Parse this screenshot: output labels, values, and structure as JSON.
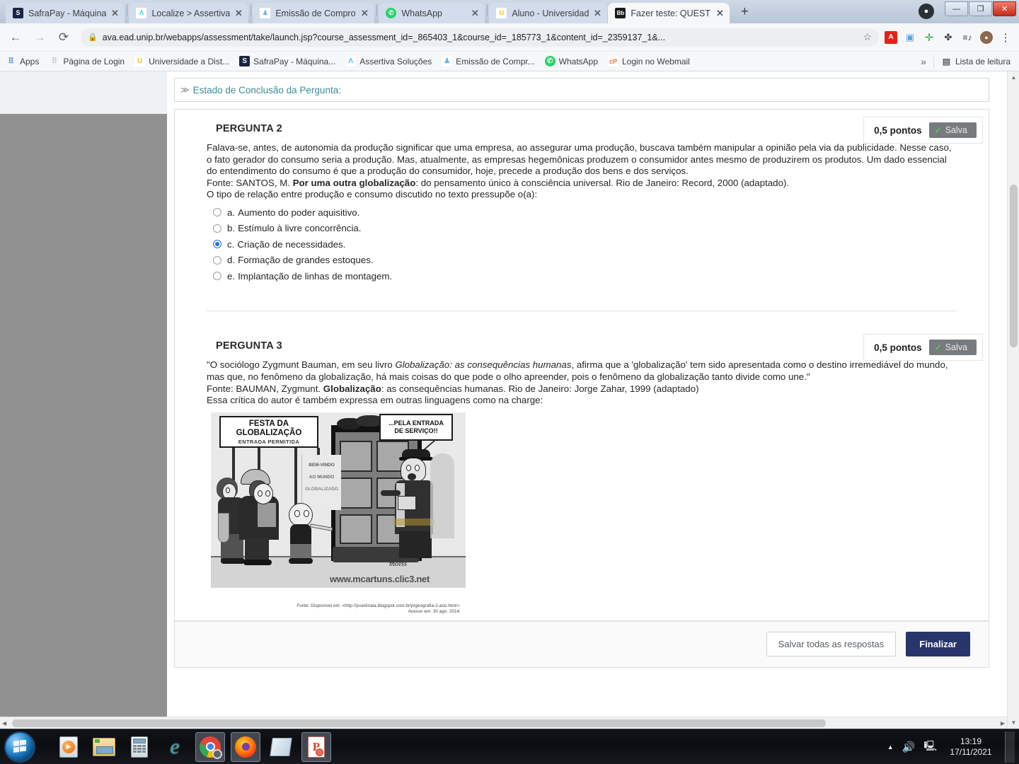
{
  "browser": {
    "tabs": [
      {
        "title": "SafraPay - Máquina ",
        "favicon": "safrapay-icon",
        "favicon_color": "#1b2440",
        "favicon_glyph": "S",
        "active": false
      },
      {
        "title": "Localize > Assertiva",
        "favicon": "assertiva-icon",
        "favicon_color": "#ffffff",
        "favicon_glyph": "A",
        "active": false
      },
      {
        "title": "Emissão de Comprov",
        "favicon": "prefeitura-icon",
        "favicon_color": "#ffffff",
        "favicon_glyph": "E",
        "active": false
      },
      {
        "title": "WhatsApp",
        "favicon": "whatsapp-icon",
        "favicon_color": "#25d366",
        "favicon_glyph": "W",
        "active": false
      },
      {
        "title": "Aluno - Universidad",
        "favicon": "unip-icon",
        "favicon_color": "#ffffff",
        "favicon_glyph": "U",
        "active": false
      },
      {
        "title": "Fazer teste: QUESTIO",
        "favicon": "blackboard-icon",
        "favicon_color": "#1a1a1a",
        "favicon_glyph": "Bb",
        "active": true
      }
    ],
    "new_tab_label": "+",
    "close_label": "✕",
    "window_controls": {
      "minimize": "—",
      "maximize": "❐",
      "close": "✕"
    },
    "nav": {
      "back": "←",
      "forward": "→",
      "reload": "⟳"
    },
    "omnibox": {
      "lock_icon": "lock-icon",
      "url": "ava.ead.unip.br/webapps/assessment/take/launch.jsp?course_assessment_id=_865403_1&course_id=_185773_1&content_id=_2359137_1&...",
      "star_icon": "☆"
    },
    "extensions": [
      {
        "name": "adobe-acrobat-icon",
        "glyph": "A",
        "color": "#e2231a"
      },
      {
        "name": "evernote-webclipper-icon",
        "glyph": "▣",
        "color": "#5ba4e5"
      },
      {
        "name": "add-extension-icon",
        "glyph": "✛",
        "color": "#34a853"
      },
      {
        "name": "extensions-puzzle-icon",
        "glyph": "🧩",
        "color": "#3c4043"
      },
      {
        "name": "reading-list-icon",
        "glyph": "≡♪",
        "color": "#3c4043"
      },
      {
        "name": "profile-avatar-icon",
        "glyph": "●",
        "color": "#8a6a4e"
      },
      {
        "name": "chrome-menu-icon",
        "glyph": "⋮",
        "color": "#3c4043"
      }
    ],
    "bookmarks": [
      {
        "label": "Apps",
        "icon": "apps-grid-icon",
        "color": "#4285f4",
        "glyph": "⋮⋮"
      },
      {
        "label": "Página de Login",
        "icon": "login-page-icon",
        "color": "#cfd8e3",
        "glyph": "⋮⋮"
      },
      {
        "label": "Universidade a Dist...",
        "icon": "unip-icon",
        "color": "#ffffff",
        "glyph": "U"
      },
      {
        "label": "SafraPay - Máquina...",
        "icon": "safrapay-icon",
        "color": "#1b2440",
        "glyph": "S"
      },
      {
        "label": "Assertiva Soluções",
        "icon": "assertiva-icon",
        "color": "#ffffff",
        "glyph": "A"
      },
      {
        "label": "Emissão de Compr...",
        "icon": "prefeitura-icon",
        "color": "#ffffff",
        "glyph": "E"
      },
      {
        "label": "WhatsApp",
        "icon": "whatsapp-icon",
        "color": "#25d366",
        "glyph": "W"
      },
      {
        "label": "Login no Webmail",
        "icon": "cpanel-icon",
        "color": "#ffffff",
        "glyph": "cP"
      }
    ],
    "bookmarks_overflow": "»",
    "reading_list": {
      "label": "Lista de leitura",
      "icon": "reading-list-icon"
    }
  },
  "page": {
    "status_header": {
      "chevron": "≫",
      "label": "Estado de Conclusão da Pergunta:"
    },
    "questions": [
      {
        "title": "PERGUNTA 2",
        "points": "0,5 pontos",
        "saved_label": "Salva",
        "saved_check": "✓",
        "paragraphs": [
          {
            "type": "plain",
            "text": "Falava-se, antes, de autonomia da produção significar que uma empresa, ao assegurar uma produção, buscava também manipular a opinião pela via da publicidade. Nesse caso, o fato gerador do consumo seria a produção. Mas, atualmente, as empresas hegemônicas produzem o consumidor antes mesmo de produzirem os produtos. Um dado essencial do entendimento do consumo é que a produção do consumidor, hoje, precede a produção dos bens e dos serviços."
          },
          {
            "type": "source",
            "prefix": "Fonte: SANTOS, M. ",
            "bold": "Por uma outra globalização",
            "rest": ": do pensamento único à consciência universal. Rio de Janeiro: Record, 2000 (adaptado)."
          },
          {
            "type": "plain",
            "text": "O tipo de relação entre produção e consumo discutido no texto pressupõe o(a):"
          }
        ],
        "answers": [
          {
            "letter": "a.",
            "text": "Aumento do poder aquisitivo.",
            "selected": false
          },
          {
            "letter": "b.",
            "text": "Estímulo à livre concorrência.",
            "selected": false
          },
          {
            "letter": "c.",
            "text": "Criação de necessidades.",
            "selected": true
          },
          {
            "letter": "d.",
            "text": "Formação de grandes estoques.",
            "selected": false
          },
          {
            "letter": "e.",
            "text": "Implantação de linhas de montagem.",
            "selected": false
          }
        ]
      },
      {
        "title": "PERGUNTA 3",
        "points": "0,5 pontos",
        "saved_label": "Salva",
        "saved_check": "✓",
        "quote_pre": "\"O sociólogo Zygmunt Bauman, em seu livro ",
        "quote_italic": "Globalização: as consequências humanas",
        "quote_post": ", afirma que a 'globalização' tem sido apresentada como o destino irremediável do mundo, mas que, no fenômeno da globalização, há mais coisas do que pode o olho apreender, pois o fenômeno da globalização tanto divide como une.\"",
        "source_prefix": "Fonte: BAUMAN, Zygmunt. ",
        "source_bold": "Globalização",
        "source_rest": ": as consequências humanas. Rio de Janeiro: Jorge Zahar, 1999 (adaptado)",
        "lead_in": "Essa crítica do autor é também expressa em outras linguagens como na charge:",
        "charge": {
          "name": "globalizacao-charge-image",
          "sign_line1": "FESTA DA",
          "sign_line2": "GLOBALIZAÇÃO",
          "sign_line3": "ENTRADA PERMITIDA",
          "poster_line1": "BEM-VINDO",
          "poster_line2": "AO MUNDO",
          "poster_line3": "GLOBALIZADO",
          "bubble_line1": "...PELA ENTRADA",
          "bubble_line2": "DE SERVIÇO!!",
          "watermark": "www.mcartuns.clic3.net",
          "signature": "moiśs",
          "caption_line1": "Fonte: Disponível em: <http://joselimaia.blogspot.com.br/p/geografia-2-ano.html>.",
          "caption_line2": "Acesso em: 30 ago. 2014."
        }
      }
    ],
    "actions": {
      "save_all_label": "Salvar todas as respostas",
      "finish_label": "Finalizar"
    },
    "scrollbar": {
      "up_arrow": "▲",
      "down_arrow": "▼",
      "left_arrow": "◀",
      "right_arrow": "▶"
    }
  },
  "taskbar": {
    "start_label": "start-orb",
    "items": [
      {
        "name": "windows-media-player-icon",
        "glyph": "▶",
        "active": false
      },
      {
        "name": "file-explorer-icon",
        "glyph": "📁",
        "active": false
      },
      {
        "name": "calculator-icon",
        "glyph": "🖩",
        "active": false
      },
      {
        "name": "internet-explorer-icon",
        "glyph": "e",
        "active": false
      },
      {
        "name": "google-chrome-icon",
        "glyph": "◉",
        "active": true
      },
      {
        "name": "mozilla-firefox-icon",
        "glyph": "🦊",
        "active": true
      },
      {
        "name": "sticky-notes-icon",
        "glyph": "▤",
        "active": false
      },
      {
        "name": "powerpoint-icon",
        "glyph": "P",
        "active": true
      }
    ],
    "tray": {
      "show_hidden": "▲",
      "volume_icon": "🔊",
      "network_icon": "🖧",
      "time": "13:19",
      "date": "17/11/2021"
    }
  },
  "colors": {
    "accent_blue": "#1b72e8",
    "primary_button": "#28356b",
    "teal_label": "#3a8f96",
    "saved_badge": "#777b7e",
    "saved_check": "#62c462",
    "page_gray": "#919191"
  }
}
